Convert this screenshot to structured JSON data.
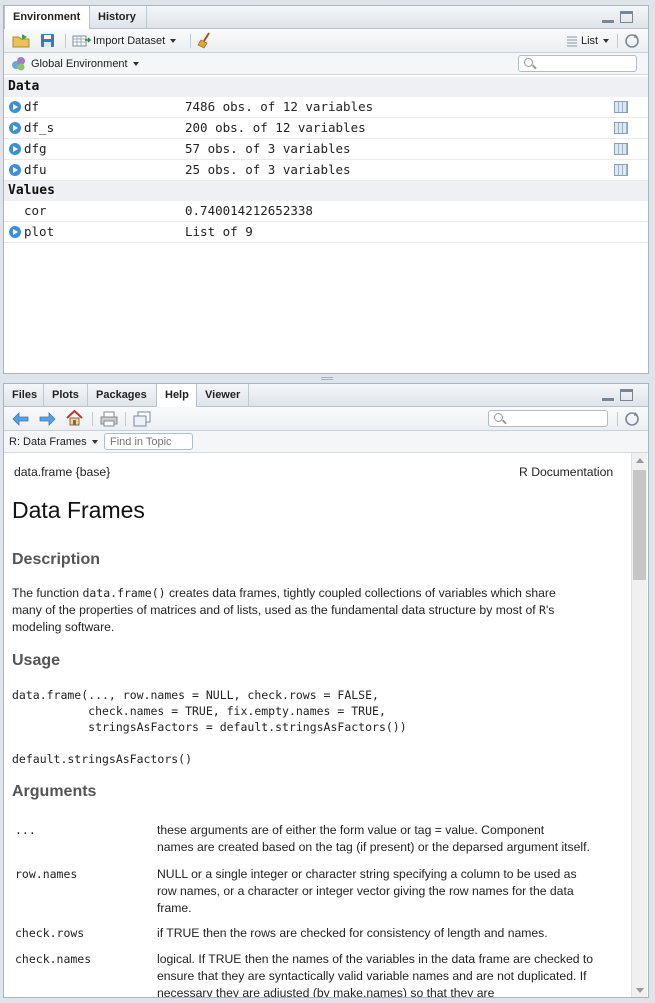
{
  "top_pane": {
    "tabs": [
      {
        "label": "Environment",
        "active": true
      },
      {
        "label": "History",
        "active": false
      }
    ],
    "toolbar": {
      "import_dataset": "Import Dataset",
      "view_mode": "List"
    },
    "scope": "Global Environment",
    "sections": {
      "data": "Data",
      "values": "Values"
    },
    "data_rows": [
      {
        "name": "df",
        "value": "7486 obs. of 12 variables"
      },
      {
        "name": "df_s",
        "value": "200 obs. of 12 variables"
      },
      {
        "name": "dfg",
        "value": "57 obs. of 3 variables"
      },
      {
        "name": "dfu",
        "value": "25 obs. of 3 variables"
      }
    ],
    "value_rows": [
      {
        "name": "cor",
        "value": "0.740014212652338",
        "expandable": false
      },
      {
        "name": "plot",
        "value": "List of 9",
        "expandable": true
      }
    ]
  },
  "bottom_pane": {
    "tabs": [
      {
        "label": "Files",
        "active": false
      },
      {
        "label": "Plots",
        "active": false
      },
      {
        "label": "Packages",
        "active": false
      },
      {
        "label": "Help",
        "active": true
      },
      {
        "label": "Viewer",
        "active": false
      }
    ],
    "topic_select": "R: Data Frames",
    "find_placeholder": "Find in Topic",
    "help": {
      "meta_left": "data.frame {base}",
      "meta_right": "R Documentation",
      "title": "Data Frames",
      "description_heading": "Description",
      "desc_1": "The function ",
      "desc_code": "data.frame()",
      "desc_2": " creates data frames, tightly coupled collections of variables which share",
      "desc_3": "many of the properties of matrices and of lists, used as the fundamental data structure by most of ",
      "desc_r": "R",
      "desc_4": "'s",
      "desc_5": "modeling software.",
      "usage_heading": "Usage",
      "usage_code": "data.frame(..., row.names = NULL, check.rows = FALSE,\n           check.names = TRUE, fix.empty.names = TRUE,\n           stringsAsFactors = default.stringsAsFactors())\n\ndefault.stringsAsFactors()",
      "arguments_heading": "Arguments",
      "args": [
        {
          "name": "...",
          "lines": [
            "these arguments are of either the form value or tag = value. Component",
            "names are created based on the tag (if present) or the deparsed argument itself."
          ]
        },
        {
          "name": "row.names",
          "lines": [
            "NULL or a single integer or character string specifying a column to be used as",
            "row names, or a character or integer vector giving the row names for the data",
            "frame."
          ]
        },
        {
          "name": "check.rows",
          "lines": [
            "if TRUE then the rows are checked for consistency of length and names."
          ]
        },
        {
          "name": "check.names",
          "lines": [
            "logical. If TRUE then the names of the variables in the data frame are checked to",
            "ensure that they are syntactically valid variable names and are not duplicated. If",
            "necessary they are adjusted (by make.names) so that they are"
          ]
        }
      ]
    }
  },
  "colors": {
    "accent_blue": "#3d8fd6",
    "link": "#2a32b8",
    "heading_gray": "#555555"
  }
}
